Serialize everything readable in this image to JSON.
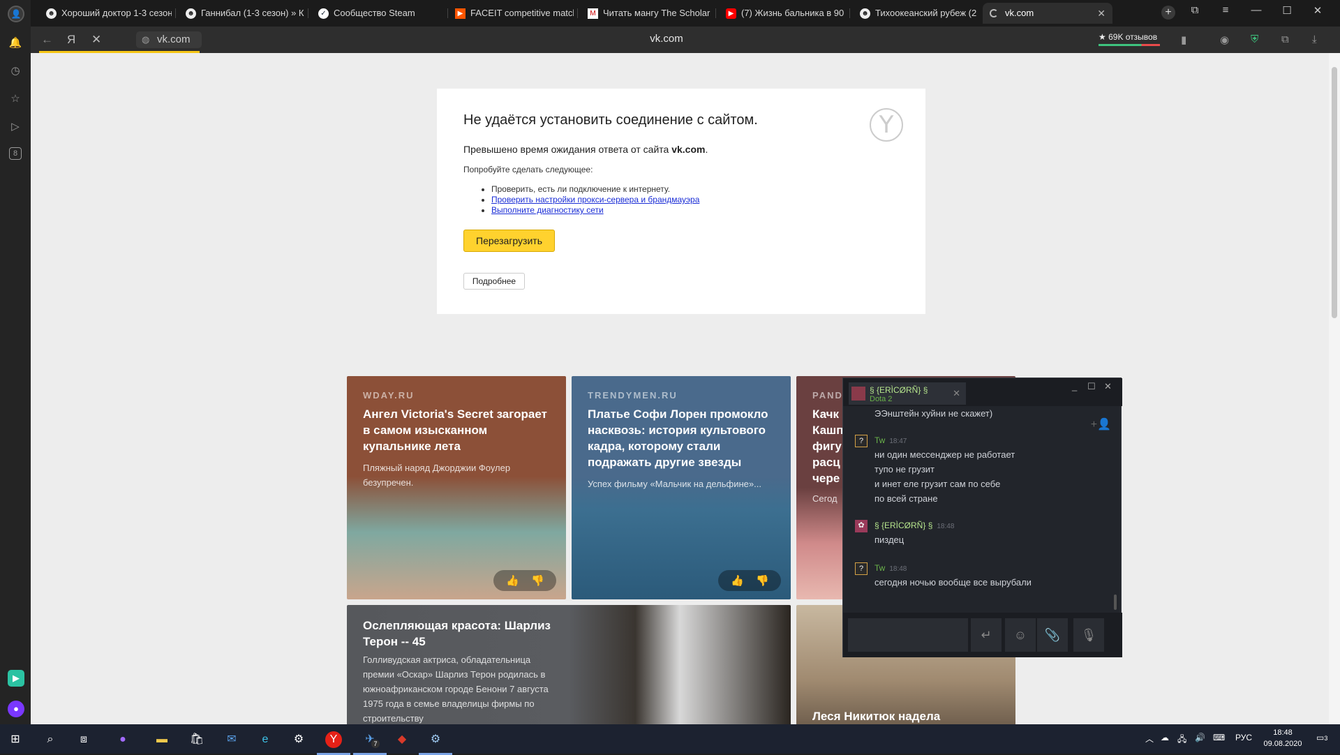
{
  "browser": {
    "tabs": [
      {
        "label": "Хороший доктор 1-3 сезон",
        "icon": "mask-icon"
      },
      {
        "label": "Ганнибал (1-3 сезон) » К",
        "icon": "mask-icon"
      },
      {
        "label": "Сообщество Steam",
        "icon": "steam-icon"
      },
      {
        "label": "FACEIT competitive match",
        "icon": "faceit-icon"
      },
      {
        "label": "Читать мангу The Scholar",
        "icon": "manga-icon"
      },
      {
        "label": "(7) Жизнь бальника в 90",
        "icon": "youtube-icon"
      },
      {
        "label": "Тихоокеанский рубеж (2",
        "icon": "mask-icon"
      },
      {
        "label": "vk.com",
        "icon": "loading-icon",
        "active": true
      }
    ],
    "address": "vk.com",
    "page_title": "vk.com",
    "reviews": "★ 69K отзывов",
    "yandex_letter": "Я"
  },
  "error": {
    "heading": "Не удаётся установить соединение с сайтом.",
    "subtitle_prefix": "Превышено время ожидания ответа от сайта ",
    "subtitle_site": "vk.com",
    "subtitle_suffix": ".",
    "try_label": "Попробуйте сделать следующее:",
    "tips": [
      "Проверить, есть ли подключение к интернету.",
      "Проверить настройки прокси-сервера и брандмауэра",
      "Выполните диагностику сети"
    ],
    "reload_label": "Перезагрузить",
    "details_label": "Подробнее"
  },
  "feed": {
    "cards": [
      {
        "source": "WDAY.RU",
        "title": "Ангел Victoria's Secret загорает в самом изысканном купальнике лета",
        "desc": "Пляжный наряд Джорджии Фоулер безупречен.",
        "color": "#8c5038"
      },
      {
        "source": "TRENDYMEN.RU",
        "title": "Платье Софи Лорен промокло насквозь: история культового кадра, которому стали подражать другие звезды",
        "desc": "Успех фильму «Мальчик на дельфине»...",
        "color": "#4a6a8c"
      },
      {
        "source": "PAND",
        "title": "Качк Кашп фигу расц чере",
        "desc": "Сегод",
        "color": "#6a4040"
      },
      {
        "title": "Ослепляющая красота: Шарлиз Терон -- 45",
        "desc": "Голливудская актриса, обладательница премии «Оскар» Шарлиз Терон родилась в южноафриканском городе Бенони 7 августа 1975 года в семье владелицы фирмы по строительству",
        "color": "#56585c"
      },
      {
        "title": "Леся Никитюк надела",
        "color": "#8a7a6a"
      }
    ]
  },
  "chat": {
    "tab_name": "§ {ERÌCØRÑ} §",
    "tab_game": "Dota 2",
    "messages": [
      {
        "text": "ЭЭнштейн хуйни не скажет)"
      },
      {
        "author": "Tw",
        "time": "18:47",
        "lines": [
          "ни один мессенджер не работает",
          "тупо не грузит",
          "и инет еле грузит сам по себе",
          "по всей стране"
        ]
      },
      {
        "author": "§ {ERÌCØRÑ} §",
        "time": "18:48",
        "lines": [
          "пиздец"
        ]
      },
      {
        "author": "Tw",
        "time": "18:48",
        "lines": [
          "сегодня ночью вообще все вырубали"
        ]
      }
    ]
  },
  "taskbar": {
    "lang": "РУС",
    "time": "18:48",
    "date": "09.08.2020",
    "notif_count": "3",
    "telegram_badge": "7"
  }
}
